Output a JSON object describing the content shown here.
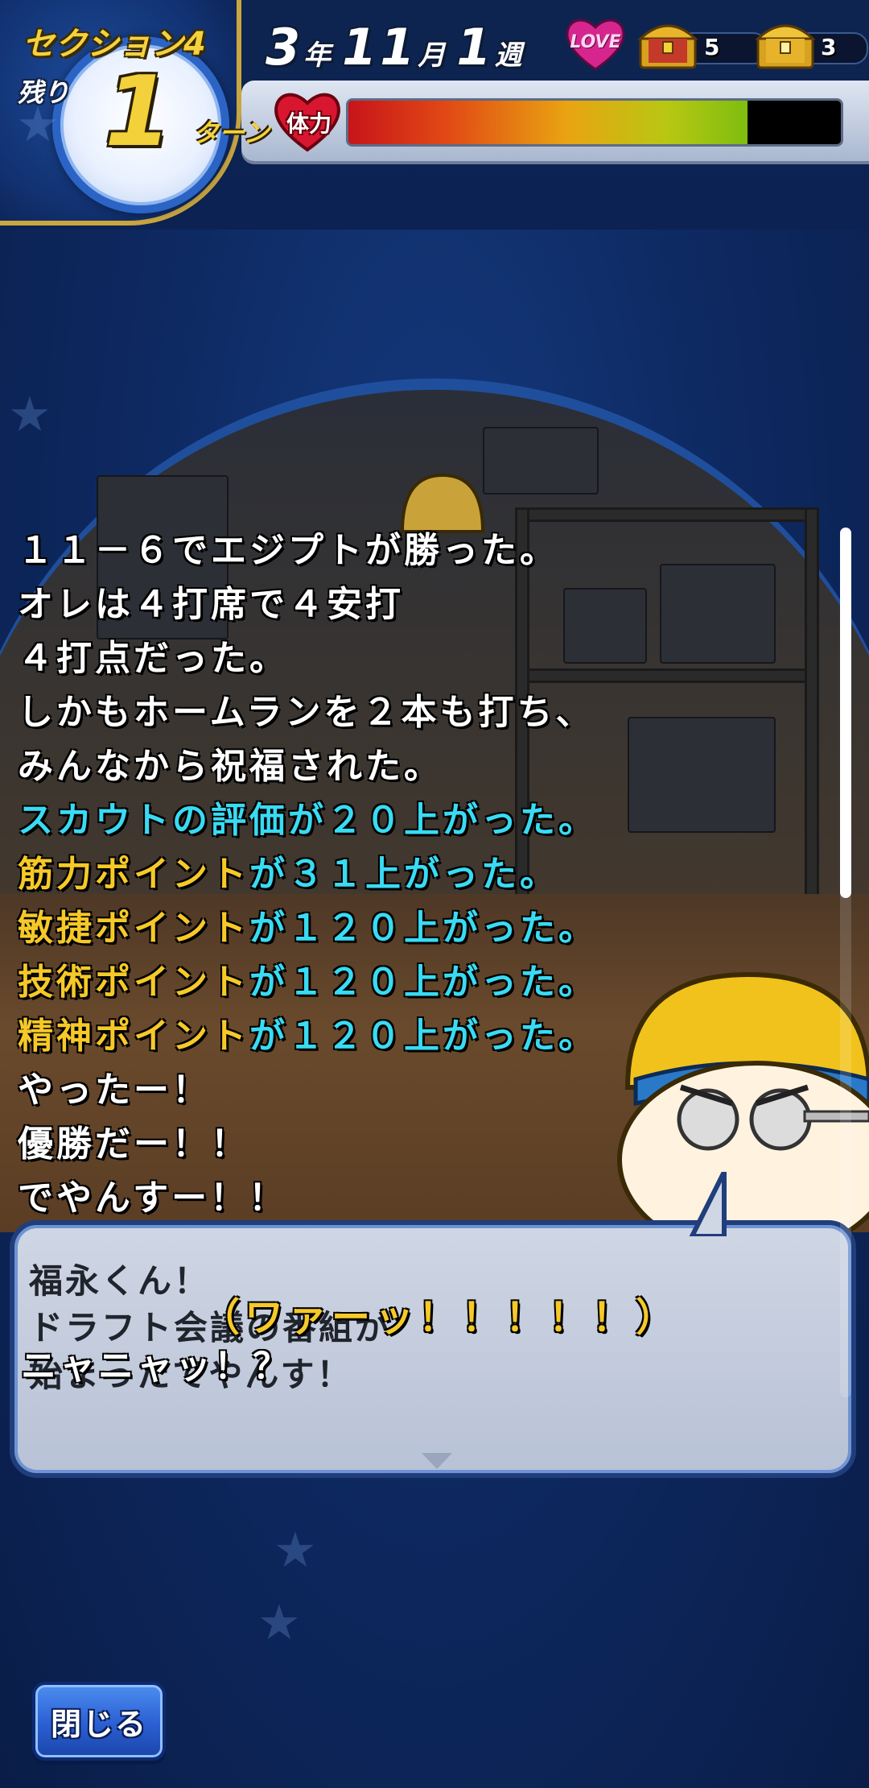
{
  "header": {
    "section_label": "セクション4",
    "remaining_label": "残り",
    "turns_remaining": "1",
    "turn_unit": "ターン",
    "date": {
      "year": "3",
      "year_unit": "年",
      "month": "11",
      "month_unit": "月",
      "week": "1",
      "week_unit": "週"
    },
    "love_label": "LOVE",
    "chests": [
      {
        "name": "treasure-chest-red",
        "count": "5"
      },
      {
        "name": "treasure-chest-gold",
        "count": "3"
      }
    ],
    "stamina": {
      "label": "体力",
      "level_fraction": 0.81,
      "icon": "heart-icon"
    }
  },
  "story_log": {
    "lines": [
      {
        "text": "１１－６でエジプトが勝った。"
      },
      {
        "text": "オレは４打席で４安打"
      },
      {
        "text": "４打点だった。"
      },
      {
        "text": "しかもホームランを２本も打ち、"
      },
      {
        "text": "みんなから祝福された。"
      },
      {
        "prefix": "スカウトの評価",
        "prefix_color": "cyan",
        "suffix": "が２０上がった。"
      },
      {
        "prefix": "筋力ポイント",
        "prefix_color": "gold",
        "suffix": "が３１上がった。"
      },
      {
        "prefix": "敏捷ポイント",
        "prefix_color": "gold",
        "suffix": "が１２０上がった。"
      },
      {
        "prefix": "技術ポイント",
        "prefix_color": "gold",
        "suffix": "が１２０上がった。"
      },
      {
        "prefix": "精神ポイント",
        "prefix_color": "gold",
        "suffix": "が１２０上がった。"
      },
      {
        "text": "やったー！"
      },
      {
        "text": "優勝だー！！"
      },
      {
        "text": "でやんすー！！"
      }
    ]
  },
  "dialog": {
    "lines": [
      "福永くん！",
      "ドラフト会議の番組が",
      "始まったでやんす！"
    ],
    "sound_effect": "（ワァーッ！！！！！）",
    "overlay_line": "ニャニャッ！？"
  },
  "footer": {
    "close_label": "閉じる"
  },
  "colors": {
    "accent_gold": "#f6c928",
    "accent_cyan": "#39dbf3",
    "panel_blue": "#203e7c",
    "button_blue": "#2a5fd2"
  }
}
